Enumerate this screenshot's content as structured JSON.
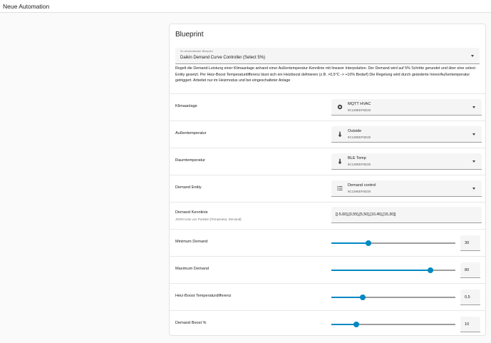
{
  "topbar": {
    "title": "Neue Automation"
  },
  "card": {
    "title": "Blueprint",
    "blueprint_select": {
      "label": "Zu verwendender Blueprint",
      "value": "Daikin Demand Curve Controller (Select 5%)"
    },
    "description": "Regelt die Demand-Leistung einer Klimaanlage anhand einer Außentemperatur-Kennlinie mit linearer Interpolation. Der Demand wird auf 5% Schritte gerundet und über eine select-Entity gesetzt. Per Heiz-Boost Temperaturdifferenz lässt sich ein Heizboost definieren (z.B. >0,5°C -> +10% Bedarf) Die Regelung wird durch geänderte Innen/Außentemperatur getriggert. Arbeitet nur im Heizmodus und bei eingeschalteter Anlage"
  },
  "inputs": {
    "klimaanlage": {
      "label": "Klimaanlage",
      "entity_name": "MQTT HVAC",
      "entity_id": "9C139EEF6D28",
      "icon": "hvac-icon"
    },
    "aussentemperatur": {
      "label": "Außentemperatur",
      "entity_name": "Outside",
      "entity_id": "9C139EEF6D28",
      "icon": "thermometer-icon"
    },
    "raumtemperatur": {
      "label": "Raumtemperatur",
      "entity_name": "BLE Temp",
      "entity_id": "9C139EEF6D28",
      "icon": "thermometer-icon"
    },
    "demand_entity": {
      "label": "Demand Entity",
      "entity_name": "Demand control",
      "entity_id": "9C139EEF6D28",
      "icon": "list-icon"
    },
    "kennlinie": {
      "label": "Demand Kennlinie",
      "sublabel": "JSON Liste von Punkten [Temperatur, Demand]",
      "value": "[[-5,60],[0,55],[5,50],[10,45],[15,30]]"
    },
    "minimum_demand": {
      "label": "Minimum Demand",
      "value": "30",
      "fraction": 0.3
    },
    "maximum_demand": {
      "label": "Maximum Demand",
      "value": "80",
      "fraction": 0.8
    },
    "heiz_boost": {
      "label": "Heiz-Boost Temperaturdifferenz",
      "value": "0,5",
      "fraction": 0.25
    },
    "demand_boost": {
      "label": "Demand Boost %",
      "value": "10",
      "fraction": 0.2
    }
  },
  "colors": {
    "accent": "#0288c2",
    "background": "#fafafa"
  }
}
